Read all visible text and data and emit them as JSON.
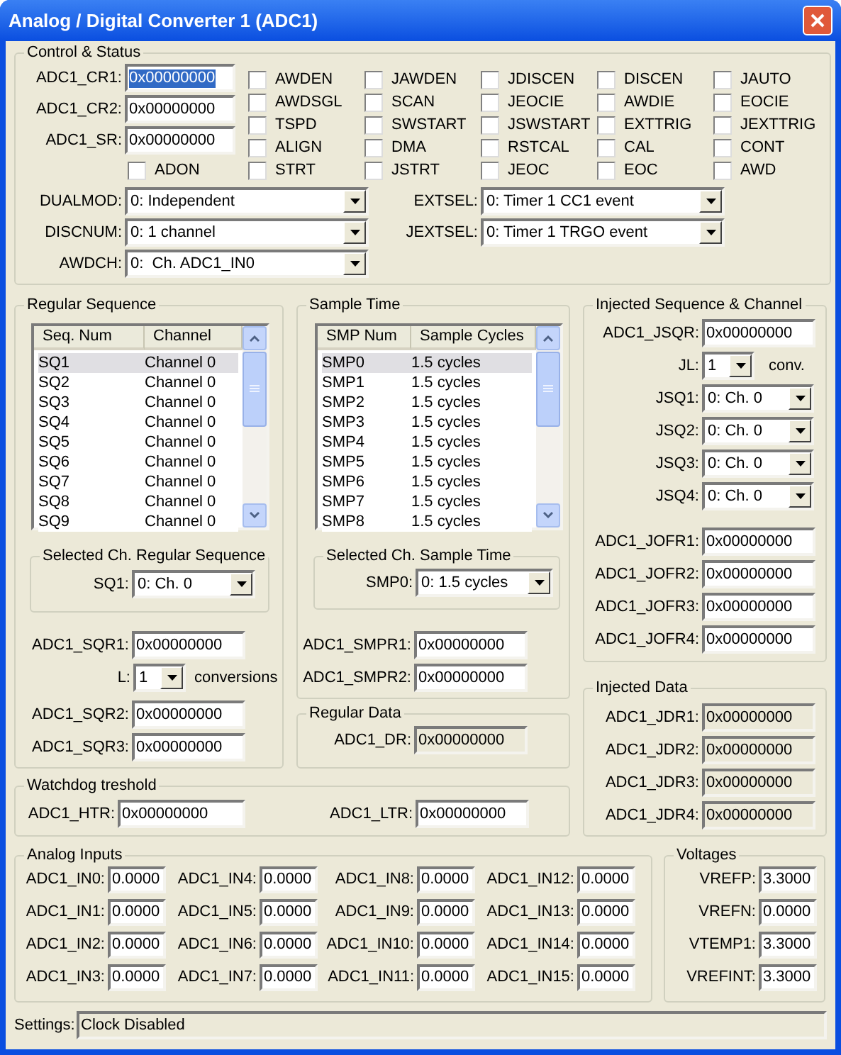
{
  "window": {
    "title": "Analog / Digital Converter 1 (ADC1)"
  },
  "control_status": {
    "title": "Control & Status",
    "registers": [
      {
        "label": "ADC1_CR1:",
        "value": "0x00000000",
        "text_selected": true
      },
      {
        "label": "ADC1_CR2:",
        "value": "0x00000000",
        "text_selected": false
      },
      {
        "label": "ADC1_SR:",
        "value": "0x00000000",
        "text_selected": false
      }
    ],
    "register_flag": {
      "label": "ADON",
      "checked": false
    },
    "flags": [
      {
        "label": "AWDEN",
        "checked": false
      },
      {
        "label": "JAWDEN",
        "checked": false
      },
      {
        "label": "JDISCEN",
        "checked": false
      },
      {
        "label": "DISCEN",
        "checked": false
      },
      {
        "label": "JAUTO",
        "checked": false
      },
      {
        "label": "AWDSGL",
        "checked": false
      },
      {
        "label": "SCAN",
        "checked": false
      },
      {
        "label": "JEOCIE",
        "checked": false
      },
      {
        "label": "AWDIE",
        "checked": false
      },
      {
        "label": "EOCIE",
        "checked": false
      },
      {
        "label": "TSPD",
        "checked": false
      },
      {
        "label": "SWSTART",
        "checked": false
      },
      {
        "label": "JSWSTART",
        "checked": false
      },
      {
        "label": "EXTTRIG",
        "checked": false
      },
      {
        "label": "JEXTTRIG",
        "checked": false
      },
      {
        "label": "ALIGN",
        "checked": false
      },
      {
        "label": "DMA",
        "checked": false
      },
      {
        "label": "RSTCAL",
        "checked": false
      },
      {
        "label": "CAL",
        "checked": false
      },
      {
        "label": "CONT",
        "checked": false
      },
      {
        "label": "STRT",
        "checked": false
      },
      {
        "label": "JSTRT",
        "checked": false
      },
      {
        "label": "JEOC",
        "checked": false
      },
      {
        "label": "EOC",
        "checked": false
      },
      {
        "label": "AWD",
        "checked": false
      }
    ],
    "selects_left": [
      {
        "label": "DUALMOD:",
        "value": "0: Independent"
      },
      {
        "label": "DISCNUM:",
        "value": "0: 1 channel"
      },
      {
        "label": "AWDCH:",
        "value": "0:  Ch. ADC1_IN0"
      }
    ],
    "selects_right": [
      {
        "label": "EXTSEL:",
        "value": "0: Timer 1 CC1 event"
      },
      {
        "label": "JEXTSEL:",
        "value": "0: Timer 1 TRGO event"
      }
    ]
  },
  "regular_sequence": {
    "title": "Regular Sequence",
    "list": {
      "columns": [
        "Seq. Num",
        "Channel"
      ],
      "rows": [
        {
          "cells": [
            "SQ1",
            "Channel 0"
          ],
          "selected": true
        },
        {
          "cells": [
            "SQ2",
            "Channel 0"
          ],
          "selected": false
        },
        {
          "cells": [
            "SQ3",
            "Channel 0"
          ],
          "selected": false
        },
        {
          "cells": [
            "SQ4",
            "Channel 0"
          ],
          "selected": false
        },
        {
          "cells": [
            "SQ5",
            "Channel 0"
          ],
          "selected": false
        },
        {
          "cells": [
            "SQ6",
            "Channel 0"
          ],
          "selected": false
        },
        {
          "cells": [
            "SQ7",
            "Channel 0"
          ],
          "selected": false
        },
        {
          "cells": [
            "SQ8",
            "Channel 0"
          ],
          "selected": false
        },
        {
          "cells": [
            "SQ9",
            "Channel 0"
          ],
          "selected": false
        }
      ]
    },
    "selection": {
      "title": "Selected Ch. Regular Sequence",
      "label": "SQ1:",
      "value": "0: Ch. 0"
    },
    "register_top": {
      "label": "ADC1_SQR1:",
      "value": "0x00000000"
    },
    "length": {
      "label": "L:",
      "value": "1",
      "unit": "conversions"
    },
    "registers_bottom": [
      {
        "label": "ADC1_SQR2:",
        "value": "0x00000000"
      },
      {
        "label": "ADC1_SQR3:",
        "value": "0x00000000"
      }
    ]
  },
  "sample_time": {
    "title": "Sample Time",
    "list": {
      "columns": [
        "SMP Num",
        "Sample Cycles"
      ],
      "rows": [
        {
          "cells": [
            "SMP0",
            "1.5 cycles"
          ],
          "selected": true
        },
        {
          "cells": [
            "SMP1",
            "1.5 cycles"
          ],
          "selected": false
        },
        {
          "cells": [
            "SMP2",
            "1.5 cycles"
          ],
          "selected": false
        },
        {
          "cells": [
            "SMP3",
            "1.5 cycles"
          ],
          "selected": false
        },
        {
          "cells": [
            "SMP4",
            "1.5 cycles"
          ],
          "selected": false
        },
        {
          "cells": [
            "SMP5",
            "1.5 cycles"
          ],
          "selected": false
        },
        {
          "cells": [
            "SMP6",
            "1.5 cycles"
          ],
          "selected": false
        },
        {
          "cells": [
            "SMP7",
            "1.5 cycles"
          ],
          "selected": false
        },
        {
          "cells": [
            "SMP8",
            "1.5 cycles"
          ],
          "selected": false
        }
      ]
    },
    "selection": {
      "title": "Selected Ch. Sample Time",
      "label": "SMP0:",
      "value": "0: 1.5 cycles"
    },
    "registers": [
      {
        "label": "ADC1_SMPR1:",
        "value": "0x00000000"
      },
      {
        "label": "ADC1_SMPR2:",
        "value": "0x00000000"
      }
    ]
  },
  "regular_data": {
    "title": "Regular Data",
    "registers": [
      {
        "label": "ADC1_DR:",
        "value": "0x00000000",
        "read_only": true
      }
    ]
  },
  "watchdog": {
    "title": "Watchdog treshold",
    "registers": [
      {
        "label": "ADC1_HTR:",
        "value": "0x00000000"
      },
      {
        "label": "ADC1_LTR:",
        "value": "0x00000000"
      }
    ]
  },
  "injected_sequence": {
    "title": "Injected Sequence & Channel",
    "register": {
      "label": "ADC1_JSQR:",
      "value": "0x00000000"
    },
    "length": {
      "label": "JL:",
      "value": "1",
      "unit": "conv."
    },
    "selects": [
      {
        "label": "JSQ1:",
        "value": "0: Ch. 0"
      },
      {
        "label": "JSQ2:",
        "value": "0: Ch. 0"
      },
      {
        "label": "JSQ3:",
        "value": "0: Ch. 0"
      },
      {
        "label": "JSQ4:",
        "value": "0: Ch. 0"
      }
    ],
    "offsets": [
      {
        "label": "ADC1_JOFR1:",
        "value": "0x00000000"
      },
      {
        "label": "ADC1_JOFR2:",
        "value": "0x00000000"
      },
      {
        "label": "ADC1_JOFR3:",
        "value": "0x00000000"
      },
      {
        "label": "ADC1_JOFR4:",
        "value": "0x00000000"
      }
    ]
  },
  "injected_data": {
    "title": "Injected Data",
    "registers": [
      {
        "label": "ADC1_JDR1:",
        "value": "0x00000000",
        "read_only": true
      },
      {
        "label": "ADC1_JDR2:",
        "value": "0x00000000",
        "read_only": true
      },
      {
        "label": "ADC1_JDR3:",
        "value": "0x00000000",
        "read_only": true
      },
      {
        "label": "ADC1_JDR4:",
        "value": "0x00000000",
        "read_only": true
      }
    ]
  },
  "analog_inputs": {
    "title": "Analog Inputs",
    "inputs": [
      {
        "label": "ADC1_IN0:",
        "value": "0.0000"
      },
      {
        "label": "ADC1_IN1:",
        "value": "0.0000"
      },
      {
        "label": "ADC1_IN2:",
        "value": "0.0000"
      },
      {
        "label": "ADC1_IN3:",
        "value": "0.0000"
      },
      {
        "label": "ADC1_IN4:",
        "value": "0.0000"
      },
      {
        "label": "ADC1_IN5:",
        "value": "0.0000"
      },
      {
        "label": "ADC1_IN6:",
        "value": "0.0000"
      },
      {
        "label": "ADC1_IN7:",
        "value": "0.0000"
      },
      {
        "label": "ADC1_IN8:",
        "value": "0.0000"
      },
      {
        "label": "ADC1_IN9:",
        "value": "0.0000"
      },
      {
        "label": "ADC1_IN10:",
        "value": "0.0000"
      },
      {
        "label": "ADC1_IN11:",
        "value": "0.0000"
      },
      {
        "label": "ADC1_IN12:",
        "value": "0.0000"
      },
      {
        "label": "ADC1_IN13:",
        "value": "0.0000"
      },
      {
        "label": "ADC1_IN14:",
        "value": "0.0000"
      },
      {
        "label": "ADC1_IN15:",
        "value": "0.0000"
      }
    ]
  },
  "voltages": {
    "title": "Voltages",
    "inputs": [
      {
        "label": "VREFP:",
        "value": "3.3000"
      },
      {
        "label": "VREFN:",
        "value": "0.0000"
      },
      {
        "label": "VTEMP1:",
        "value": "3.3000"
      },
      {
        "label": "VREFINT:",
        "value": "3.3000"
      }
    ]
  },
  "status": {
    "label": "Settings:",
    "value": "Clock Disabled",
    "read_only": true
  }
}
